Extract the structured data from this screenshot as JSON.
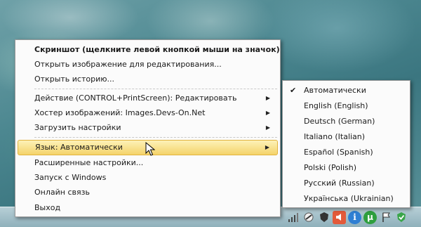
{
  "context_menu": {
    "items": [
      {
        "label": "Скриншот (щелкните левой кнопкой мыши на значок)",
        "bold": true
      },
      {
        "label": "Открыть изображение для редактирования..."
      },
      {
        "label": "Открыть историю..."
      },
      {
        "label": "Действие (CONTROL+PrintScreen): Редактировать",
        "submenu": true
      },
      {
        "label": "Хостер изображений: Images.Devs-On.Net",
        "submenu": true
      },
      {
        "label": "Загрузить настройки",
        "submenu": true
      },
      {
        "label": "Язык: Автоматически",
        "submenu": true,
        "highlighted": true
      },
      {
        "label": "Расширенные настройки..."
      },
      {
        "label": "Запуск с Windows"
      },
      {
        "label": "Онлайн связь"
      },
      {
        "label": "Выход"
      }
    ],
    "submenu_arrow": "▶"
  },
  "language_submenu": {
    "checkmark": "✔",
    "selected_index": 0,
    "items": [
      {
        "label": "Автоматически"
      },
      {
        "label": "English (English)"
      },
      {
        "label": "Deutsch (German)"
      },
      {
        "label": "Italiano (Italian)"
      },
      {
        "label": "Español (Spanish)"
      },
      {
        "label": "Polski (Polish)"
      },
      {
        "label": "Русский (Russian)"
      },
      {
        "label": "Українська (Ukrainian)"
      }
    ]
  },
  "tray_icons": [
    "signal-bars-icon",
    "screenshot-app-icon",
    "shield-icon",
    "volume-icon",
    "info-icon",
    "torrent-icon",
    "action-center-flag-icon",
    "security-shield-icon"
  ],
  "colors": {
    "highlight_top": "#fdf2b8",
    "highlight_bottom": "#f4d36a",
    "highlight_border": "#e2b33f",
    "menu_bg": "#fbfbfb"
  }
}
